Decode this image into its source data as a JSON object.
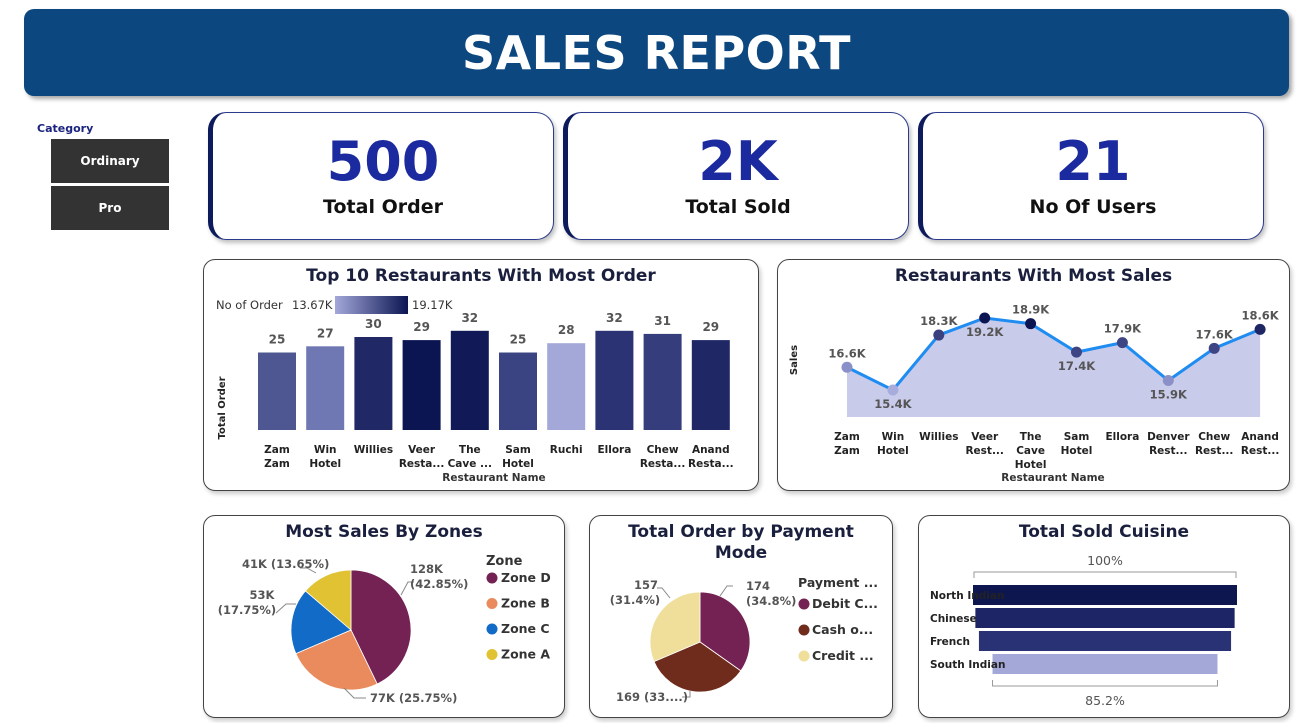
{
  "header": {
    "title": "SALES REPORT"
  },
  "filters": {
    "category_label": "Category",
    "options": [
      "Ordinary",
      "Pro"
    ]
  },
  "kpis": [
    {
      "value": "500",
      "label": "Total Order"
    },
    {
      "value": "2K",
      "label": "Total Sold"
    },
    {
      "value": "21",
      "label": "No Of Users"
    }
  ],
  "chart_data": [
    {
      "type": "bar",
      "title": "Top 10 Restaurants With Most Order",
      "xlabel": "Restaurant Name",
      "ylabel": "Total Order",
      "legend": {
        "title": "No of Order",
        "min_label": "13.67K",
        "max_label": "19.17K",
        "placement": "top-left"
      },
      "categories": [
        "Zam Zam",
        "Win Hotel",
        "Willies",
        "Veer Resta...",
        "The Cave ...",
        "Sam Hotel",
        "Ruchi",
        "Ellora",
        "Chew Resta...",
        "Anand Resta..."
      ],
      "category_lines": [
        [
          "Zam",
          "Zam"
        ],
        [
          "Win",
          "Hotel"
        ],
        [
          "Willies"
        ],
        [
          "Veer",
          "Resta..."
        ],
        [
          "The",
          "Cave ..."
        ],
        [
          "Sam",
          "Hotel"
        ],
        [
          "Ruchi"
        ],
        [
          "Ellora"
        ],
        [
          "Chew",
          "Resta..."
        ],
        [
          "Anand",
          "Resta..."
        ]
      ],
      "values": [
        25,
        27,
        30,
        29,
        32,
        25,
        28,
        32,
        31,
        29
      ],
      "colors": [
        "#4e5791",
        "#6f78b2",
        "#202866",
        "#0b1552",
        "#111a56",
        "#3b4483",
        "#a3a8d9",
        "#2b3375",
        "#353d7c",
        "#1f2865"
      ],
      "ylim": [
        0,
        34
      ],
      "grid": false
    },
    {
      "type": "area",
      "title": "Restaurants With Most Sales",
      "xlabel": "Restaurant Name",
      "ylabel": "Sales",
      "categories": [
        "Zam Zam",
        "Win Hotel",
        "Willies",
        "Veer Rest...",
        "The Cave Hotel",
        "Sam Hotel",
        "Ellora",
        "Denver Rest...",
        "Chew Rest...",
        "Anand Rest..."
      ],
      "category_lines": [
        [
          "Zam",
          "Zam"
        ],
        [
          "Win",
          "Hotel"
        ],
        [
          "Willies"
        ],
        [
          "Veer",
          "Rest..."
        ],
        [
          "The",
          "Cave",
          "Hotel"
        ],
        [
          "Sam",
          "Hotel"
        ],
        [
          "Ellora"
        ],
        [
          "Denver",
          "Rest..."
        ],
        [
          "Chew",
          "Rest..."
        ],
        [
          "Anand",
          "Rest..."
        ]
      ],
      "values": [
        16.6,
        15.4,
        18.3,
        19.2,
        18.9,
        17.4,
        17.9,
        15.9,
        17.6,
        18.6
      ],
      "value_labels": [
        "16.6K",
        "15.4K",
        "18.3K",
        "19.2K",
        "18.9K",
        "17.4K",
        "17.9K",
        "15.9K",
        "17.6K",
        "18.6K"
      ],
      "label_positions": [
        "above",
        "below",
        "above",
        "below",
        "above",
        "below",
        "above",
        "below",
        "above",
        "above"
      ],
      "point_colors": [
        "#8a90c8",
        "#a7acdc",
        "#3a417e",
        "#0b1552",
        "#0b1552",
        "#3e4585",
        "#3e4585",
        "#8a90c8",
        "#3e4585",
        "#1e2664"
      ],
      "line_color": "#1e8cf0",
      "area_color": "#c9cbea",
      "ylim": [
        14.5,
        19.5
      ],
      "unit": "K",
      "grid": false
    },
    {
      "type": "pie",
      "title": "Most Sales By Zones",
      "legend": {
        "title": "Zone",
        "placement": "right"
      },
      "labels": [
        "Zone D",
        "Zone B",
        "Zone C",
        "Zone A"
      ],
      "values": [
        128,
        77,
        53,
        41
      ],
      "percent": [
        42.85,
        25.75,
        17.75,
        13.65
      ],
      "slice_labels": [
        "128K (42.85%)",
        "77K (25.75%)",
        "53K (17.75%)",
        "41K (13.65%)"
      ],
      "colors": [
        "#742253",
        "#e98b5d",
        "#126bc6",
        "#e1c232"
      ]
    },
    {
      "type": "pie",
      "title": "Total Order by Payment Mode",
      "title_lines": [
        "Total Order by Payment",
        "Mode"
      ],
      "legend": {
        "title": "Payment ...",
        "placement": "right"
      },
      "labels": [
        "Debit C...",
        "Cash o...",
        "Credit ..."
      ],
      "values": [
        174,
        169,
        157
      ],
      "percent": [
        34.8,
        33.8,
        31.4
      ],
      "slice_labels": [
        "174 (34.8%)",
        "169 (33....)",
        "157 (31.4%)"
      ],
      "colors": [
        "#742253",
        "#6f2c1c",
        "#efdf9b"
      ]
    },
    {
      "type": "bar",
      "orientation": "horizontal",
      "title": "Total Sold Cuisine",
      "categories": [
        "North Indian",
        "Chinese",
        "French",
        "South Indian"
      ],
      "percent": [
        100,
        98.2,
        95.5,
        85.2
      ],
      "top_label": "100%",
      "bottom_label": "85.2%",
      "colors": [
        "#0e1650",
        "#1d2566",
        "#2a3276",
        "#a3a8d9"
      ]
    }
  ]
}
